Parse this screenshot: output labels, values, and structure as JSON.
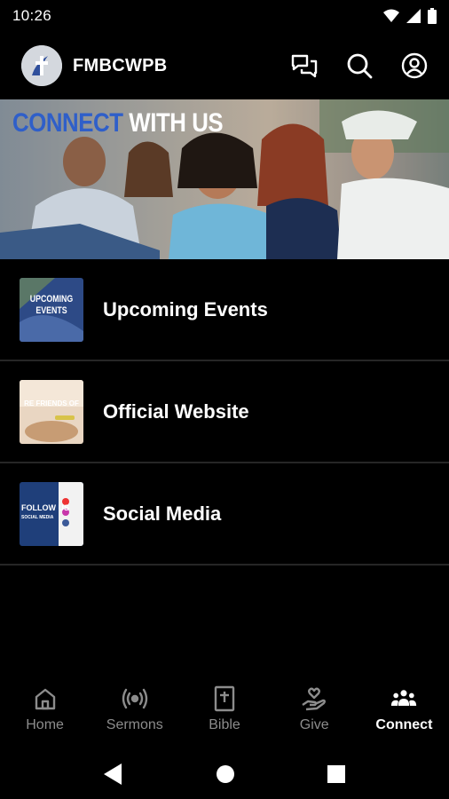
{
  "status_bar": {
    "time": "10:26"
  },
  "app_bar": {
    "title": "FMBCWPB"
  },
  "banner": {
    "title_part1": "CONNECT",
    "title_part2": " WITH US"
  },
  "list": {
    "items": [
      {
        "label": "Upcoming Events",
        "thumb_text": [
          "UPCOMING",
          "EVENTS"
        ]
      },
      {
        "label": "Official Website",
        "thumb_text": "RE FRIENDS OF"
      },
      {
        "label": "Social Media",
        "thumb_text": [
          "FOLLOW US",
          "SOCIAL MEDIA"
        ]
      }
    ]
  },
  "bottom_nav": {
    "items": [
      {
        "label": "Home",
        "icon": "home-icon",
        "active": false
      },
      {
        "label": "Sermons",
        "icon": "broadcast-icon",
        "active": false
      },
      {
        "label": "Bible",
        "icon": "bible-icon",
        "active": false
      },
      {
        "label": "Give",
        "icon": "give-icon",
        "active": false
      },
      {
        "label": "Connect",
        "icon": "people-icon",
        "active": true
      }
    ]
  },
  "colors": {
    "background": "#000000",
    "banner_accent": "#2f5fc9",
    "inactive_nav": "#8c8c8c",
    "divider": "#262626"
  }
}
